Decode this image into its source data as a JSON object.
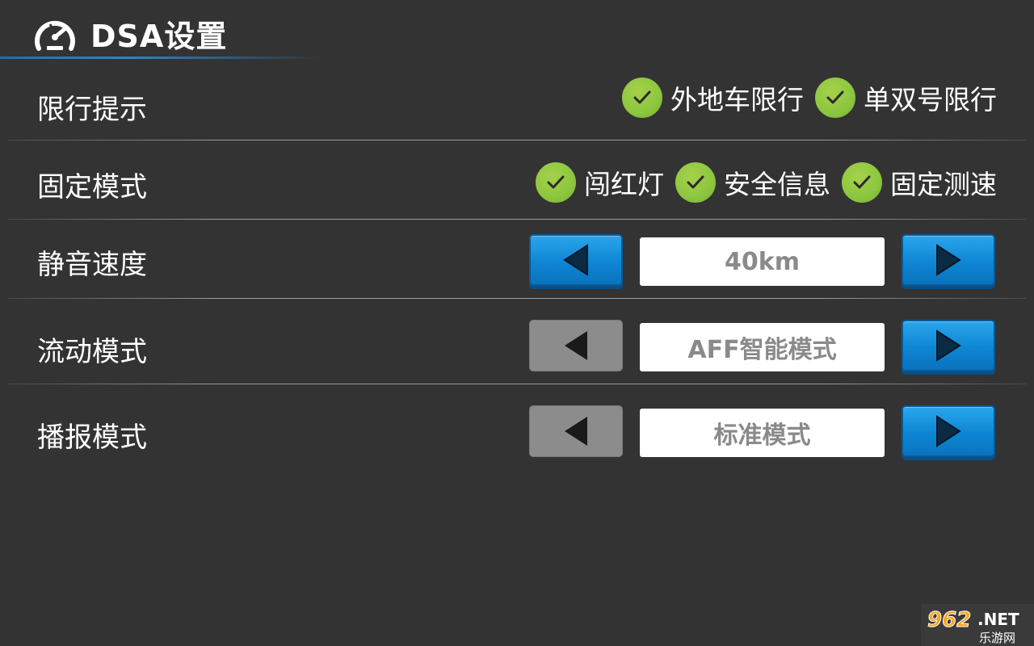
{
  "header": {
    "title": "DSA设置",
    "icon": "speedometer-icon"
  },
  "rows": {
    "restriction": {
      "label": "限行提示",
      "options": [
        {
          "label": "外地车限行",
          "checked": true
        },
        {
          "label": "单双号限行",
          "checked": true
        }
      ]
    },
    "fixed_mode": {
      "label": "固定模式",
      "options": [
        {
          "label": "闯红灯",
          "checked": true
        },
        {
          "label": "安全信息",
          "checked": true
        },
        {
          "label": "固定测速",
          "checked": true
        }
      ]
    },
    "mute_speed": {
      "label": "静音速度",
      "value": "40km",
      "prev_enabled": true,
      "next_enabled": true
    },
    "mobile_mode": {
      "label": "流动模式",
      "value": "AFF智能模式",
      "prev_enabled": false,
      "next_enabled": true
    },
    "broadcast_mode": {
      "label": "播报模式",
      "value": "标准模式",
      "prev_enabled": false,
      "next_enabled": true
    }
  },
  "watermark": {
    "top": "962.NET",
    "bottom": "乐游网"
  },
  "colors": {
    "background": "#333333",
    "check_green": "#8cc63f",
    "button_blue": "#0e86d4",
    "button_disabled": "#8c8c8c",
    "value_text": "#8a8a8a",
    "accent_line": "#2a86c8"
  }
}
